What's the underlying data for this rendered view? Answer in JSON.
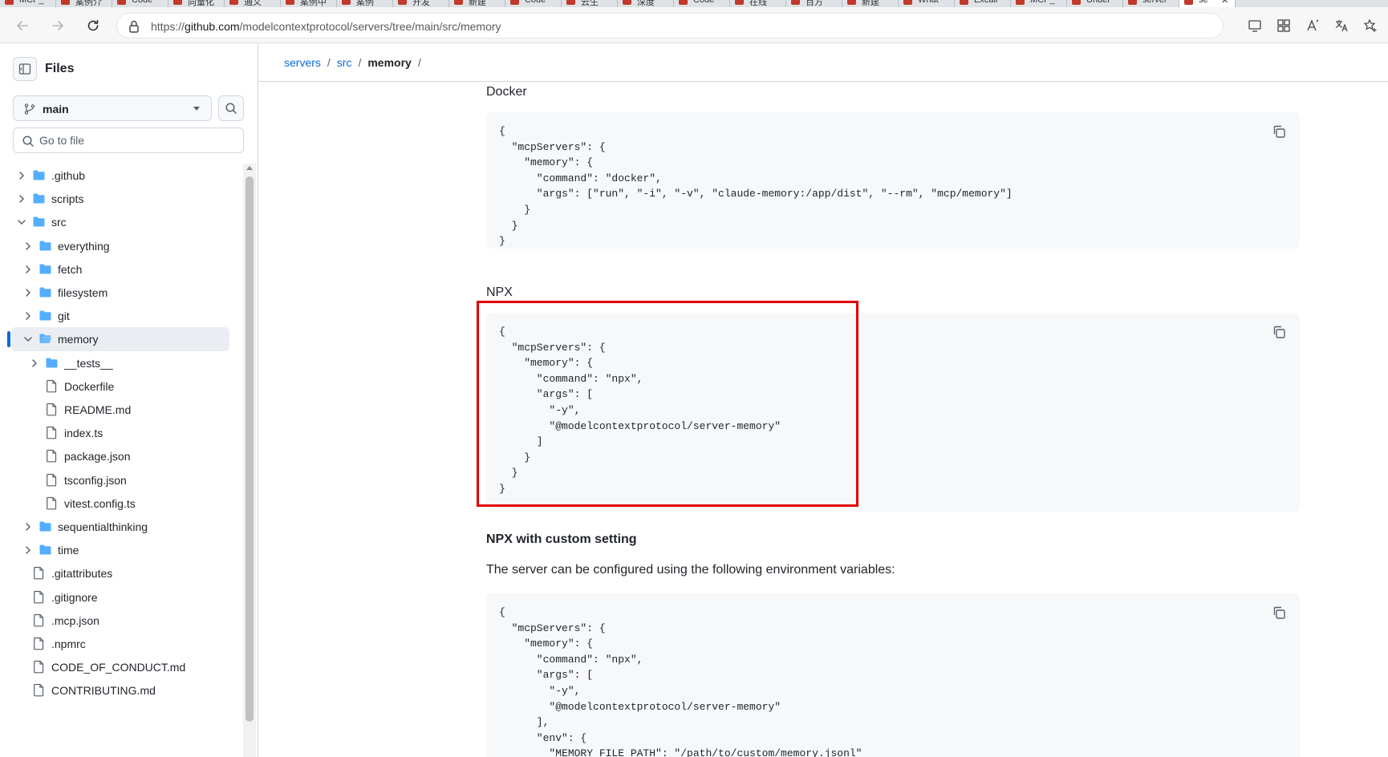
{
  "browser": {
    "tabs": [
      {
        "label": "MCP_"
      },
      {
        "label": "案例介"
      },
      {
        "label": "Code"
      },
      {
        "label": "向量化"
      },
      {
        "label": "通义"
      },
      {
        "label": "案例中"
      },
      {
        "label": "案例"
      },
      {
        "label": "开发"
      },
      {
        "label": "新建"
      },
      {
        "label": "Code"
      },
      {
        "label": "云生"
      },
      {
        "label": "深度"
      },
      {
        "label": "Code"
      },
      {
        "label": "在线"
      },
      {
        "label": "百方"
      },
      {
        "label": "新建"
      },
      {
        "label": "What"
      },
      {
        "label": "Excali"
      },
      {
        "label": "MCP_"
      },
      {
        "label": "Under"
      },
      {
        "label": "server"
      },
      {
        "label": "se",
        "active": true
      }
    ],
    "url_prefix": "https://",
    "url_host": "github.com",
    "url_path": "/modelcontextprotocol/servers/tree/main/src/memory"
  },
  "sidebar": {
    "title": "Files",
    "branch": "main",
    "search_placeholder": "Go to file",
    "tree": [
      {
        "label": ".github",
        "type": "folder",
        "depth": 0,
        "chevron": "right"
      },
      {
        "label": "scripts",
        "type": "folder",
        "depth": 0,
        "chevron": "right"
      },
      {
        "label": "src",
        "type": "folder",
        "depth": 0,
        "chevron": "down"
      },
      {
        "label": "everything",
        "type": "folder",
        "depth": 1,
        "chevron": "right"
      },
      {
        "label": "fetch",
        "type": "folder",
        "depth": 1,
        "chevron": "right"
      },
      {
        "label": "filesystem",
        "type": "folder",
        "depth": 1,
        "chevron": "right"
      },
      {
        "label": "git",
        "type": "folder",
        "depth": 1,
        "chevron": "right"
      },
      {
        "label": "memory",
        "type": "folder-open",
        "depth": 1,
        "chevron": "down",
        "selected": true
      },
      {
        "label": "__tests__",
        "type": "folder",
        "depth": 2,
        "chevron": "right"
      },
      {
        "label": "Dockerfile",
        "type": "file",
        "depth": 2
      },
      {
        "label": "README.md",
        "type": "file",
        "depth": 2
      },
      {
        "label": "index.ts",
        "type": "file",
        "depth": 2
      },
      {
        "label": "package.json",
        "type": "file",
        "depth": 2
      },
      {
        "label": "tsconfig.json",
        "type": "file",
        "depth": 2
      },
      {
        "label": "vitest.config.ts",
        "type": "file",
        "depth": 2
      },
      {
        "label": "sequentialthinking",
        "type": "folder",
        "depth": 1,
        "chevron": "right"
      },
      {
        "label": "time",
        "type": "folder",
        "depth": 1,
        "chevron": "right"
      },
      {
        "label": ".gitattributes",
        "type": "file",
        "depth": 0
      },
      {
        "label": ".gitignore",
        "type": "file",
        "depth": 0
      },
      {
        "label": ".mcp.json",
        "type": "file",
        "depth": 0
      },
      {
        "label": ".npmrc",
        "type": "file",
        "depth": 0
      },
      {
        "label": "CODE_OF_CONDUCT.md",
        "type": "file",
        "depth": 0
      },
      {
        "label": "CONTRIBUTING.md",
        "type": "file",
        "depth": 0
      }
    ]
  },
  "breadcrumb": {
    "items": [
      {
        "label": "servers",
        "link": true
      },
      {
        "label": "src",
        "link": true
      },
      {
        "label": "memory",
        "link": false
      }
    ],
    "trailing": "/"
  },
  "content": {
    "docker_heading": "Docker",
    "docker_code": "{\n  \"mcpServers\": {\n    \"memory\": {\n      \"command\": \"docker\",\n      \"args\": [\"run\", \"-i\", \"-v\", \"claude-memory:/app/dist\", \"--rm\", \"mcp/memory\"]\n    }\n  }\n}",
    "npx_heading": "NPX",
    "npx_code": "{\n  \"mcpServers\": {\n    \"memory\": {\n      \"command\": \"npx\",\n      \"args\": [\n        \"-y\",\n        \"@modelcontextprotocol/server-memory\"\n      ]\n    }\n  }\n}",
    "npx_custom_heading": "NPX with custom setting",
    "npx_custom_text": "The server can be configured using the following environment variables:",
    "npx_custom_code": "{\n  \"mcpServers\": {\n    \"memory\": {\n      \"command\": \"npx\",\n      \"args\": [\n        \"-y\",\n        \"@modelcontextprotocol/server-memory\"\n      ],\n      \"env\": {\n        \"MEMORY_FILE_PATH\": \"/path/to/custom/memory.jsonl\""
  },
  "colors": {
    "link": "#0969da",
    "highlight_box": "#e00000",
    "code_bg": "#f6f8fa",
    "folder": "#54aeff"
  }
}
